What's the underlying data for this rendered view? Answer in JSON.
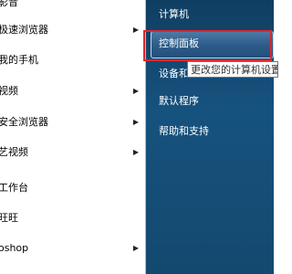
{
  "left_programs": [
    {
      "label": "影音",
      "has_arrow": false
    },
    {
      "label": "极速浏览器",
      "has_arrow": true
    },
    {
      "label": "我的手机",
      "has_arrow": false
    },
    {
      "label": "视频",
      "has_arrow": true
    },
    {
      "label": "安全浏览器",
      "has_arrow": true
    },
    {
      "label": "艺视频",
      "has_arrow": true
    },
    {
      "label": "工作台",
      "has_arrow": false
    },
    {
      "label": "旺旺",
      "has_arrow": false
    },
    {
      "label": "oshop",
      "has_arrow": true
    }
  ],
  "right_items": {
    "computer": "计算机",
    "control_panel": "控制面板",
    "devices": "设备和",
    "default_programs": "默认程序",
    "help": "帮助和支持"
  },
  "tooltip": "更改您的计算机设置",
  "arrow_glyph": "▶",
  "colors": {
    "right_pane": "#16527e",
    "highlight": "#2d5d8b",
    "annotation": "#e0262b"
  }
}
